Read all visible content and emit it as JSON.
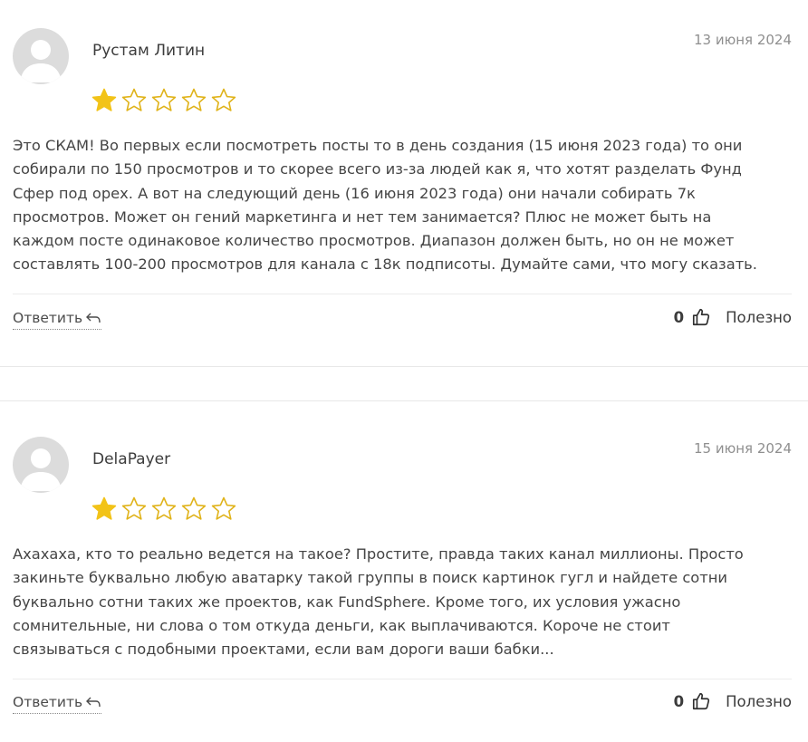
{
  "reviews": [
    {
      "author": "Рустам Литин",
      "date": "13 июня 2024",
      "rating": 1,
      "rating_max": 5,
      "text_lines": [
        "Это СКАМ! Во первых если посмотреть посты то в день создания (15 июня 2023 года) то они",
        "собирали по 150 просмотров и то скорее всего из-за людей как я, что хотят разделать Фунд",
        "Сфер под орех. А вот на следующий день (16 июня 2023 года) они начали собирать 7к",
        "просмотров. Может он гений маркетинга и нет тем занимается? Плюс не может быть на",
        "каждом посте одинаковое количество просмотров. Диапазон должен быть, но он не может",
        "составлять 100-200 просмотров для канала с 18к подписоты. Думайте сами, что могу сказать."
      ],
      "reply_label": "Ответить",
      "helpful_count": "0",
      "helpful_label": "Полезно"
    },
    {
      "author": "DelaPayer",
      "date": "15 июня 2024",
      "rating": 1,
      "rating_max": 5,
      "text_lines": [
        "Ахахаха, кто то реально ведется на такое? Простите, правда таких канал миллионы. Просто",
        "закиньте буквально любую аватарку такой группы в поиск картинок гугл и найдете сотни",
        "буквально сотни таких же проектов, как FundSphere. Кроме того, их условия ужасно",
        "сомнительные, ни слова о том откуда деньги, как выплачиваются. Короче не стоит",
        "связываться с подобными проектами, если вам дороги ваши бабки..."
      ],
      "reply_label": "Ответить",
      "helpful_count": "0",
      "helpful_label": "Полезно"
    }
  ],
  "colors": {
    "star_filled": "#f2c318",
    "star_empty_stroke": "#e0b31a",
    "avatar_bg": "#dcdcdc",
    "avatar_fg": "#ffffff"
  },
  "icons": {
    "avatar": "user-silhouette-icon",
    "star": "star-icon",
    "reply": "reply-arrow-icon",
    "helpful": "thumbs-up-icon"
  }
}
